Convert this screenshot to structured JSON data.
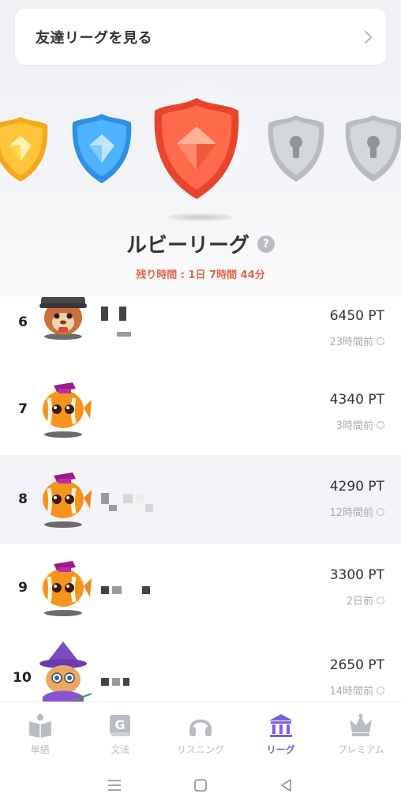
{
  "friends_league": {
    "label": "友達リーグを見る"
  },
  "league": {
    "name": "ルビーリーグ",
    "help": "?",
    "remaining": "残り時間 : 1日 7時間 44分"
  },
  "badges": [
    {
      "kind": "gold",
      "state": "unlocked"
    },
    {
      "kind": "sapphire",
      "state": "unlocked"
    },
    {
      "kind": "ruby",
      "state": "current"
    },
    {
      "kind": "locked",
      "state": "locked"
    },
    {
      "kind": "locked",
      "state": "locked"
    }
  ],
  "rows": [
    {
      "rank": "6",
      "points": "6450 PT",
      "ago": "23時間前",
      "avatar": "hamster-cap",
      "highlight": false
    },
    {
      "rank": "7",
      "points": "4340 PT",
      "ago": "3時間前",
      "avatar": "fish-grad",
      "highlight": false
    },
    {
      "rank": "8",
      "points": "4290 PT",
      "ago": "12時間前",
      "avatar": "fish-grad",
      "highlight": true
    },
    {
      "rank": "9",
      "points": "3300 PT",
      "ago": "2日前",
      "avatar": "fish-grad",
      "highlight": false
    },
    {
      "rank": "10",
      "points": "2650 PT",
      "ago": "14時間前",
      "avatar": "cat-wizard",
      "highlight": false
    }
  ],
  "nav": [
    {
      "label": "単語",
      "icon": "book-icon",
      "active": false
    },
    {
      "label": "文法",
      "icon": "grammar-icon",
      "active": false
    },
    {
      "label": "リスニング",
      "icon": "headphones-icon",
      "active": false
    },
    {
      "label": "リーグ",
      "icon": "league-icon",
      "active": true
    },
    {
      "label": "プレミアム",
      "icon": "crown-icon",
      "active": false
    }
  ],
  "colors": {
    "accent": "#7b5fe0",
    "remaining_text": "#e0664a",
    "inactive": "#b9bcc3"
  }
}
